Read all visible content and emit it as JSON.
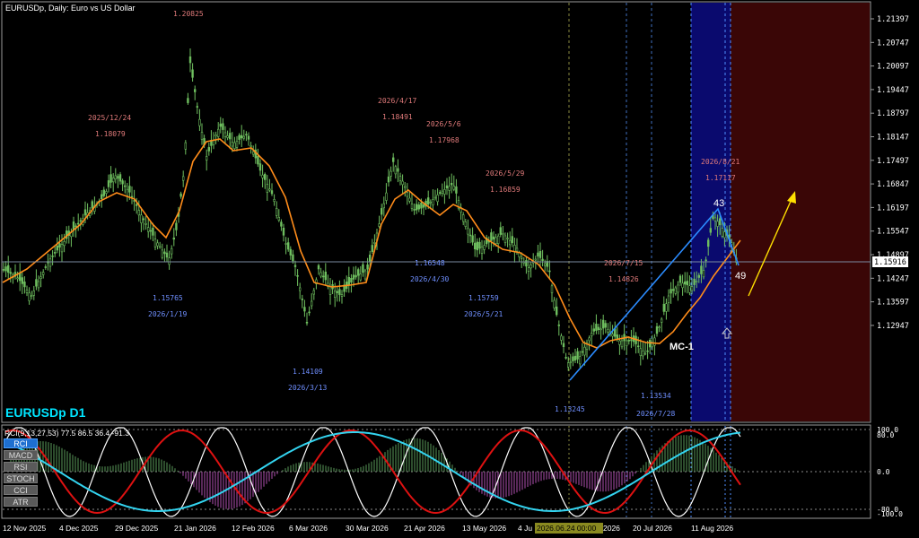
{
  "window": {
    "title": "EURUSDp, Daily:  Euro vs US Dollar",
    "symbol_label": "EURUSDp D1"
  },
  "colors": {
    "background": "#000000",
    "frame": "#9a9a9a",
    "bull_candle": "#6fbf5f",
    "ma_line": "#ff8c1a",
    "trend_line": "#2b8cff",
    "high_label": "#e07a7a",
    "low_label": "#6f8fff",
    "highlight_blue": "#0a0a6e",
    "shaded_future": "#3a0606",
    "arrow": "#ffe000",
    "symbol_label": "#00e5ff",
    "rci_fast": "#ffffff",
    "rci_mid": "#dd1111",
    "rci_slow": "#33d4f0",
    "hist_pos": "#5a9a5a",
    "hist_neg": "#b050b0"
  },
  "price_axis": {
    "labels": [
      "1.21397",
      "1.20747",
      "1.20097",
      "1.19447",
      "1.18797",
      "1.18147",
      "1.17497",
      "1.16847",
      "1.16197",
      "1.15547",
      "1.14897",
      "1.14247",
      "1.13597",
      "1.12947"
    ],
    "current_price": "1.15916"
  },
  "time_axis": {
    "labels": [
      "12 Nov 2025",
      "4 Dec 2025",
      "29 Dec 2025",
      "21 Jan 2026",
      "12 Feb 2026",
      "6 Mar 2026",
      "30 Mar 2026",
      "21 Apr 2026",
      "13 May 2026",
      "4 Ju",
      "2026.06.24 00:00",
      "2026",
      "20 Jul 2026",
      "11 Aug 2026"
    ]
  },
  "annotations": {
    "highs": [
      {
        "date": "",
        "price": "1.20825"
      },
      {
        "date": "2025/12/24",
        "price": "1.18079"
      },
      {
        "date": "2026/4/17",
        "price": "1.18491"
      },
      {
        "date": "2026/5/6",
        "price": "1.17968"
      },
      {
        "date": "2026/5/29",
        "price": "1.16859"
      },
      {
        "date": "2026/7/15",
        "price": "1.14826"
      },
      {
        "date": "2026/8/21",
        "price": "1.17117"
      }
    ],
    "lows": [
      {
        "date": "2026/1/19",
        "price": "1.15765"
      },
      {
        "date": "2026/3/13",
        "price": "1.14109"
      },
      {
        "date": "2026/4/30",
        "price": "1.16548"
      },
      {
        "date": "2026/5/21",
        "price": "1.15759"
      },
      {
        "date": "",
        "price": "1.13245"
      },
      {
        "date": "2026/7/28",
        "price": "1.13534"
      }
    ],
    "count_a": "43",
    "count_b": "49",
    "mc_label": "MC-1"
  },
  "indicator": {
    "header": "RCI(9,13,27,53) 77.5 86.5 36.4 -91.3",
    "buttons": [
      "RCI",
      "MACD",
      "RSI",
      "STOCH",
      "CCI",
      "ATR"
    ],
    "active_button": "RCI",
    "axis_labels": [
      "100.0",
      "80.0",
      "0.0",
      "-80.0",
      "-100.0"
    ]
  }
}
